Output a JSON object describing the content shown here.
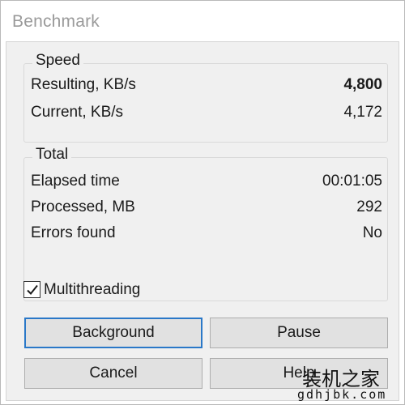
{
  "window": {
    "title": "Benchmark"
  },
  "speed": {
    "legend": "Speed",
    "resulting_label": "Resulting, KB/s",
    "resulting_value": "4,800",
    "current_label": "Current, KB/s",
    "current_value": "4,172"
  },
  "total": {
    "legend": "Total",
    "elapsed_label": "Elapsed time",
    "elapsed_value": "00:01:05",
    "processed_label": "Processed, MB",
    "processed_value": "292",
    "errors_label": "Errors found",
    "errors_value": "No"
  },
  "options": {
    "multithreading_label": "Multithreading",
    "multithreading_checked": true
  },
  "buttons": {
    "background": "Background",
    "pause": "Pause",
    "cancel": "Cancel",
    "help": "Help"
  },
  "watermark": {
    "chinese": "装机之家",
    "url": "gdhjbk.com"
  }
}
